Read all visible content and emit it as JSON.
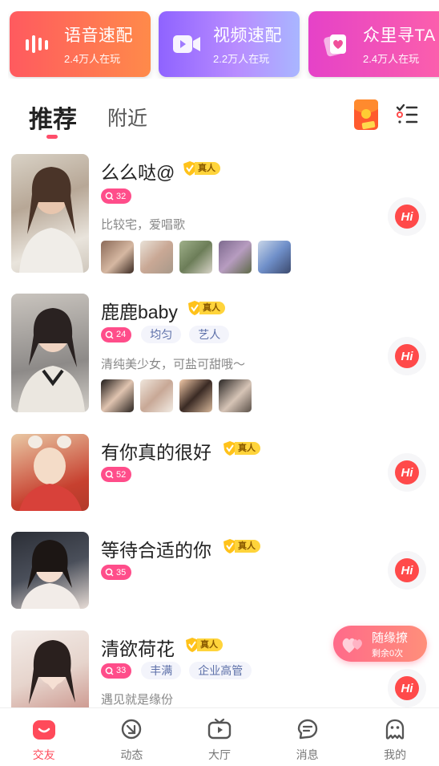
{
  "feature_cards": [
    {
      "title": "语音速配",
      "subtitle": "2.4万人在玩",
      "icon": "sound-wave-icon"
    },
    {
      "title": "视频速配",
      "subtitle": "2.2万人在玩",
      "icon": "video-camera-icon"
    },
    {
      "title": "众里寻TA",
      "subtitle": "2.4万人在玩",
      "icon": "heart-cards-icon"
    }
  ],
  "tabs": {
    "recommended": "推荐",
    "nearby": "附近",
    "active": "recommended"
  },
  "users": [
    {
      "name": "么么哒@",
      "verified": "真人",
      "count": "32",
      "tags": [],
      "bio": "比较宅，爱唱歌",
      "photo_count": 5
    },
    {
      "name": "鹿鹿baby",
      "verified": "真人",
      "count": "24",
      "tags": [
        "均匀",
        "艺人"
      ],
      "bio": "清纯美少女，可盐可甜哦～",
      "photo_count": 4
    },
    {
      "name": "有你真的很好",
      "verified": "真人",
      "count": "52",
      "tags": [],
      "bio": "",
      "photo_count": 0
    },
    {
      "name": "等待合适的你",
      "verified": "真人",
      "count": "35",
      "tags": [],
      "bio": "",
      "photo_count": 0
    },
    {
      "name": "清欲荷花",
      "verified": "真人",
      "count": "33",
      "tags": [
        "丰满",
        "企业高管"
      ],
      "bio": "遇见就是缘份",
      "photo_count": 0
    }
  ],
  "hi_label": "Hi",
  "random_match": {
    "title": "随缘撩",
    "subtitle": "剩余0次"
  },
  "bottom_nav": [
    {
      "label": "交友",
      "icon": "friends-icon",
      "active": true
    },
    {
      "label": "动态",
      "icon": "moments-icon",
      "active": false
    },
    {
      "label": "大厅",
      "icon": "tv-hall-icon",
      "active": false
    },
    {
      "label": "消息",
      "icon": "message-icon",
      "active": false
    },
    {
      "label": "我的",
      "icon": "profile-icon",
      "active": false
    }
  ],
  "colors": {
    "accent": "#ff4a5a",
    "badge": "#ff4d8a",
    "verified_gold": "#ffd43b",
    "tag_bg": "#f3f4fb",
    "tag_text": "#5c6fa8"
  }
}
